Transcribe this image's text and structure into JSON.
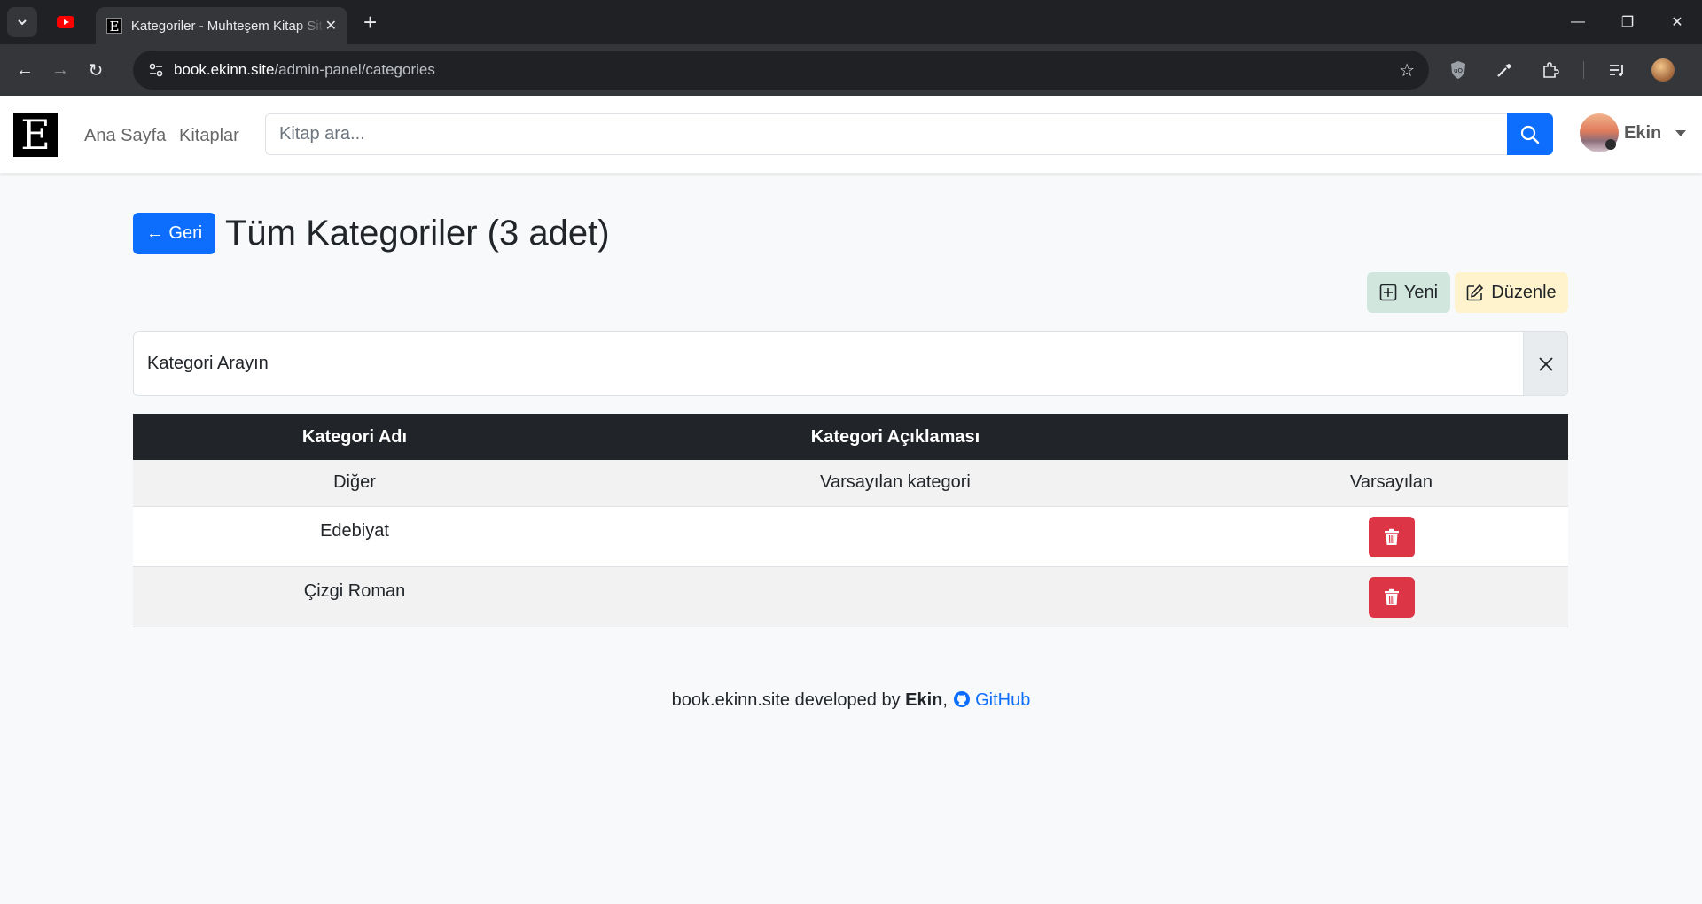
{
  "browser": {
    "tab_title": "Kategoriler - Muhteşem Kitap Sitesi",
    "url_host": "book.ekinn.site",
    "url_path": "/admin-panel/categories"
  },
  "navbar": {
    "brand": "E",
    "links": [
      "Ana Sayfa",
      "Kitaplar"
    ],
    "search_placeholder": "Kitap ara...",
    "user_name": "Ekin"
  },
  "page": {
    "back_label": "← Geri",
    "title": "Tüm Kategoriler (3 adet)",
    "new_label": "Yeni",
    "edit_label": "Düzenle",
    "filter_value": "Kategori Arayın"
  },
  "table": {
    "headers": [
      "Kategori Adı",
      "Kategori Açıklaması",
      ""
    ],
    "rows": [
      {
        "name": "Diğer",
        "description": "Varsayılan kategori",
        "action": "Varsayılan"
      },
      {
        "name": "Edebiyat",
        "description": "",
        "action": "delete"
      },
      {
        "name": "Çizgi Roman",
        "description": "",
        "action": "delete"
      }
    ]
  },
  "footer": {
    "prefix": "book.ekinn.site developed by ",
    "author": "Ekin",
    "sep": ",",
    "github": "GitHub"
  },
  "colors": {
    "primary": "#0d6efd",
    "danger": "#dc3545",
    "success_subtle": "#d1e7dd",
    "warning_subtle": "#fff3cd",
    "table_header": "#212529"
  }
}
